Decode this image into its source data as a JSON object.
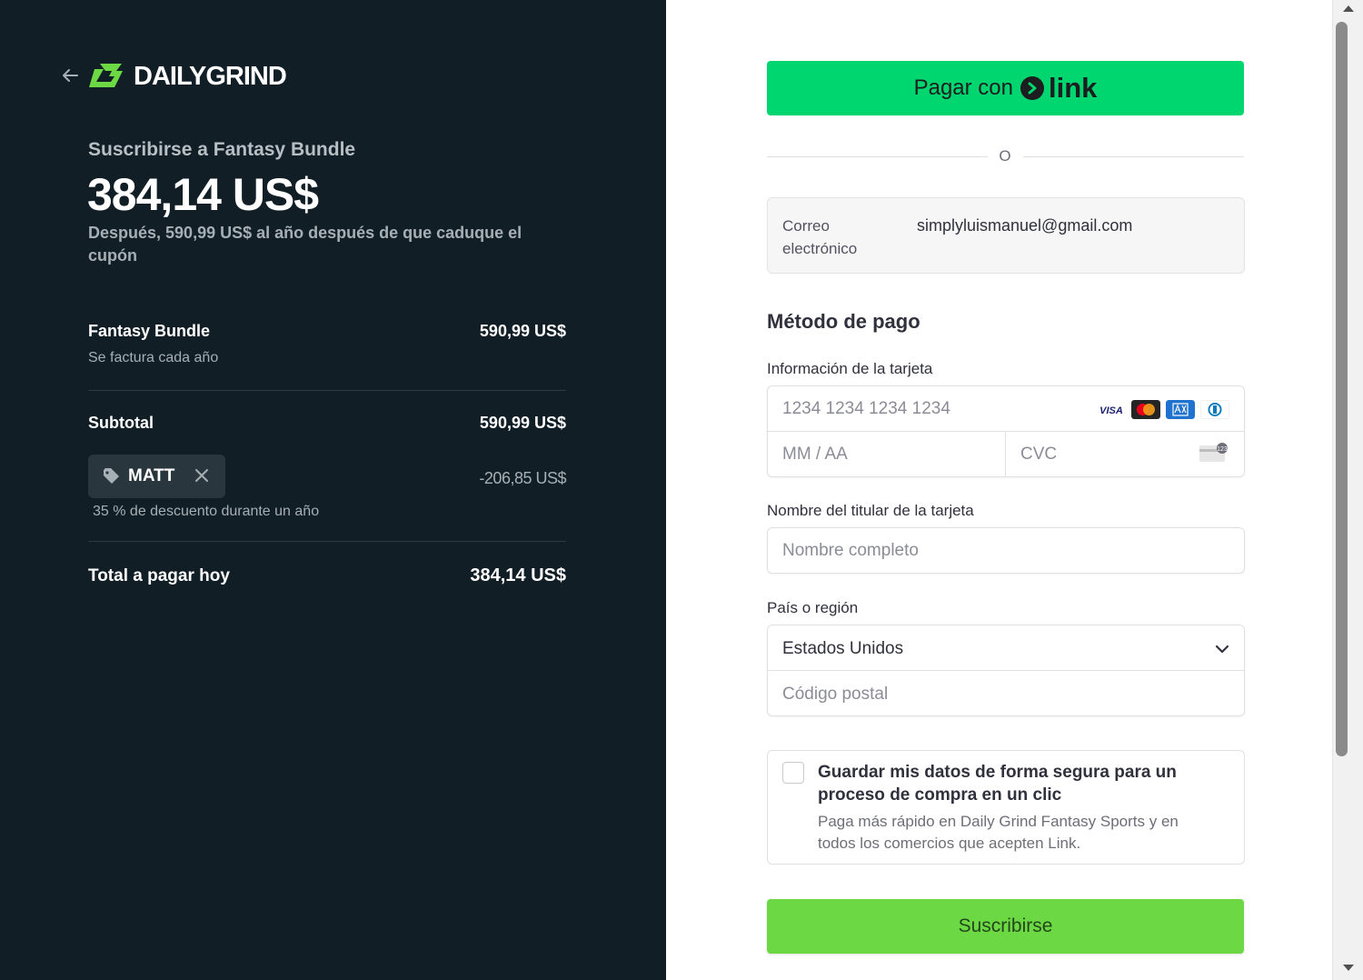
{
  "brand": {
    "name": "DAILYGRIND",
    "logo_icon": "dailygrind-logo",
    "accent": "#6cd944"
  },
  "summary": {
    "subscribe_title": "Suscribirse a Fantasy Bundle",
    "price": "384,14 US$",
    "after_note": "Después, 590,99 US$ al año después de que caduque el cupón"
  },
  "line_item": {
    "name": "Fantasy Bundle",
    "price": "590,99 US$",
    "billing": "Se factura cada año"
  },
  "subtotal": {
    "label": "Subtotal",
    "value": "590,99 US$"
  },
  "coupon": {
    "code": "MATT",
    "discount": "-206,85 US$",
    "note": "35 % de descuento durante un año"
  },
  "total": {
    "label": "Total a pagar hoy",
    "value": "384,14 US$"
  },
  "link_button": {
    "prefix": "Pagar con",
    "brand": "link",
    "color": "#00d66f"
  },
  "or_text": "O",
  "email": {
    "label": "Correo electrónico",
    "value": "simplyluismanuel@gmail.com"
  },
  "payment": {
    "title": "Método de pago",
    "card_label": "Información de la tarjeta",
    "card_placeholder": "1234 1234 1234 1234",
    "card_brands": [
      "visa",
      "mastercard",
      "amex",
      "diners"
    ],
    "expiry_placeholder": "MM / AA",
    "cvc_placeholder": "CVC",
    "cardholder_label": "Nombre del titular de la tarjeta",
    "cardholder_placeholder": "Nombre completo",
    "country_label": "País o región",
    "country_value": "Estados Unidos",
    "postal_placeholder": "Código postal"
  },
  "save_info": {
    "checked": false,
    "title": "Guardar mis datos de forma segura para un proceso de compra en un clic",
    "description": "Paga más rápido en Daily Grind Fantasy Sports y en todos los comercios que acepten Link."
  },
  "submit": {
    "label": "Suscribirse",
    "color": "#6cd944"
  }
}
